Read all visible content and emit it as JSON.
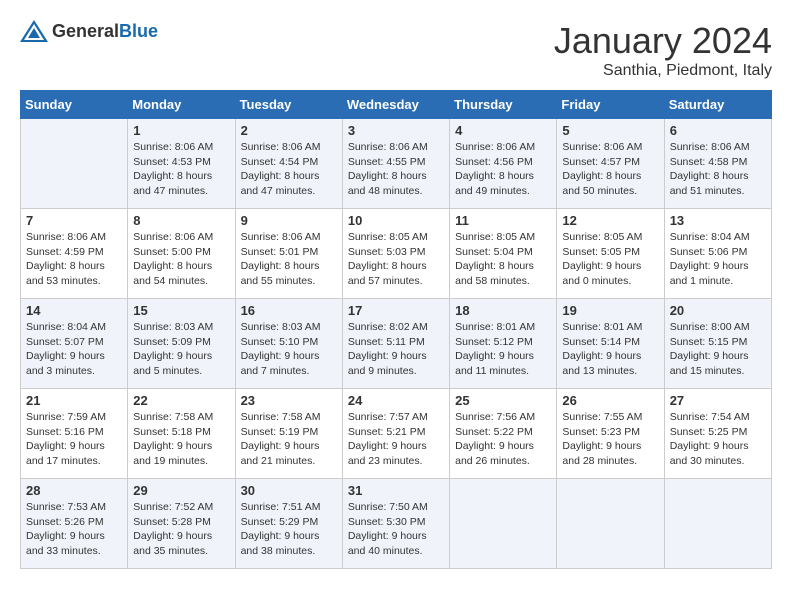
{
  "header": {
    "logo_general": "General",
    "logo_blue": "Blue",
    "month_title": "January 2024",
    "location": "Santhia, Piedmont, Italy"
  },
  "days_of_week": [
    "Sunday",
    "Monday",
    "Tuesday",
    "Wednesday",
    "Thursday",
    "Friday",
    "Saturday"
  ],
  "weeks": [
    [
      {
        "day": "",
        "info": ""
      },
      {
        "day": "1",
        "info": "Sunrise: 8:06 AM\nSunset: 4:53 PM\nDaylight: 8 hours\nand 47 minutes."
      },
      {
        "day": "2",
        "info": "Sunrise: 8:06 AM\nSunset: 4:54 PM\nDaylight: 8 hours\nand 47 minutes."
      },
      {
        "day": "3",
        "info": "Sunrise: 8:06 AM\nSunset: 4:55 PM\nDaylight: 8 hours\nand 48 minutes."
      },
      {
        "day": "4",
        "info": "Sunrise: 8:06 AM\nSunset: 4:56 PM\nDaylight: 8 hours\nand 49 minutes."
      },
      {
        "day": "5",
        "info": "Sunrise: 8:06 AM\nSunset: 4:57 PM\nDaylight: 8 hours\nand 50 minutes."
      },
      {
        "day": "6",
        "info": "Sunrise: 8:06 AM\nSunset: 4:58 PM\nDaylight: 8 hours\nand 51 minutes."
      }
    ],
    [
      {
        "day": "7",
        "info": "Sunrise: 8:06 AM\nSunset: 4:59 PM\nDaylight: 8 hours\nand 53 minutes."
      },
      {
        "day": "8",
        "info": "Sunrise: 8:06 AM\nSunset: 5:00 PM\nDaylight: 8 hours\nand 54 minutes."
      },
      {
        "day": "9",
        "info": "Sunrise: 8:06 AM\nSunset: 5:01 PM\nDaylight: 8 hours\nand 55 minutes."
      },
      {
        "day": "10",
        "info": "Sunrise: 8:05 AM\nSunset: 5:03 PM\nDaylight: 8 hours\nand 57 minutes."
      },
      {
        "day": "11",
        "info": "Sunrise: 8:05 AM\nSunset: 5:04 PM\nDaylight: 8 hours\nand 58 minutes."
      },
      {
        "day": "12",
        "info": "Sunrise: 8:05 AM\nSunset: 5:05 PM\nDaylight: 9 hours\nand 0 minutes."
      },
      {
        "day": "13",
        "info": "Sunrise: 8:04 AM\nSunset: 5:06 PM\nDaylight: 9 hours\nand 1 minute."
      }
    ],
    [
      {
        "day": "14",
        "info": "Sunrise: 8:04 AM\nSunset: 5:07 PM\nDaylight: 9 hours\nand 3 minutes."
      },
      {
        "day": "15",
        "info": "Sunrise: 8:03 AM\nSunset: 5:09 PM\nDaylight: 9 hours\nand 5 minutes."
      },
      {
        "day": "16",
        "info": "Sunrise: 8:03 AM\nSunset: 5:10 PM\nDaylight: 9 hours\nand 7 minutes."
      },
      {
        "day": "17",
        "info": "Sunrise: 8:02 AM\nSunset: 5:11 PM\nDaylight: 9 hours\nand 9 minutes."
      },
      {
        "day": "18",
        "info": "Sunrise: 8:01 AM\nSunset: 5:12 PM\nDaylight: 9 hours\nand 11 minutes."
      },
      {
        "day": "19",
        "info": "Sunrise: 8:01 AM\nSunset: 5:14 PM\nDaylight: 9 hours\nand 13 minutes."
      },
      {
        "day": "20",
        "info": "Sunrise: 8:00 AM\nSunset: 5:15 PM\nDaylight: 9 hours\nand 15 minutes."
      }
    ],
    [
      {
        "day": "21",
        "info": "Sunrise: 7:59 AM\nSunset: 5:16 PM\nDaylight: 9 hours\nand 17 minutes."
      },
      {
        "day": "22",
        "info": "Sunrise: 7:58 AM\nSunset: 5:18 PM\nDaylight: 9 hours\nand 19 minutes."
      },
      {
        "day": "23",
        "info": "Sunrise: 7:58 AM\nSunset: 5:19 PM\nDaylight: 9 hours\nand 21 minutes."
      },
      {
        "day": "24",
        "info": "Sunrise: 7:57 AM\nSunset: 5:21 PM\nDaylight: 9 hours\nand 23 minutes."
      },
      {
        "day": "25",
        "info": "Sunrise: 7:56 AM\nSunset: 5:22 PM\nDaylight: 9 hours\nand 26 minutes."
      },
      {
        "day": "26",
        "info": "Sunrise: 7:55 AM\nSunset: 5:23 PM\nDaylight: 9 hours\nand 28 minutes."
      },
      {
        "day": "27",
        "info": "Sunrise: 7:54 AM\nSunset: 5:25 PM\nDaylight: 9 hours\nand 30 minutes."
      }
    ],
    [
      {
        "day": "28",
        "info": "Sunrise: 7:53 AM\nSunset: 5:26 PM\nDaylight: 9 hours\nand 33 minutes."
      },
      {
        "day": "29",
        "info": "Sunrise: 7:52 AM\nSunset: 5:28 PM\nDaylight: 9 hours\nand 35 minutes."
      },
      {
        "day": "30",
        "info": "Sunrise: 7:51 AM\nSunset: 5:29 PM\nDaylight: 9 hours\nand 38 minutes."
      },
      {
        "day": "31",
        "info": "Sunrise: 7:50 AM\nSunset: 5:30 PM\nDaylight: 9 hours\nand 40 minutes."
      },
      {
        "day": "",
        "info": ""
      },
      {
        "day": "",
        "info": ""
      },
      {
        "day": "",
        "info": ""
      }
    ]
  ]
}
